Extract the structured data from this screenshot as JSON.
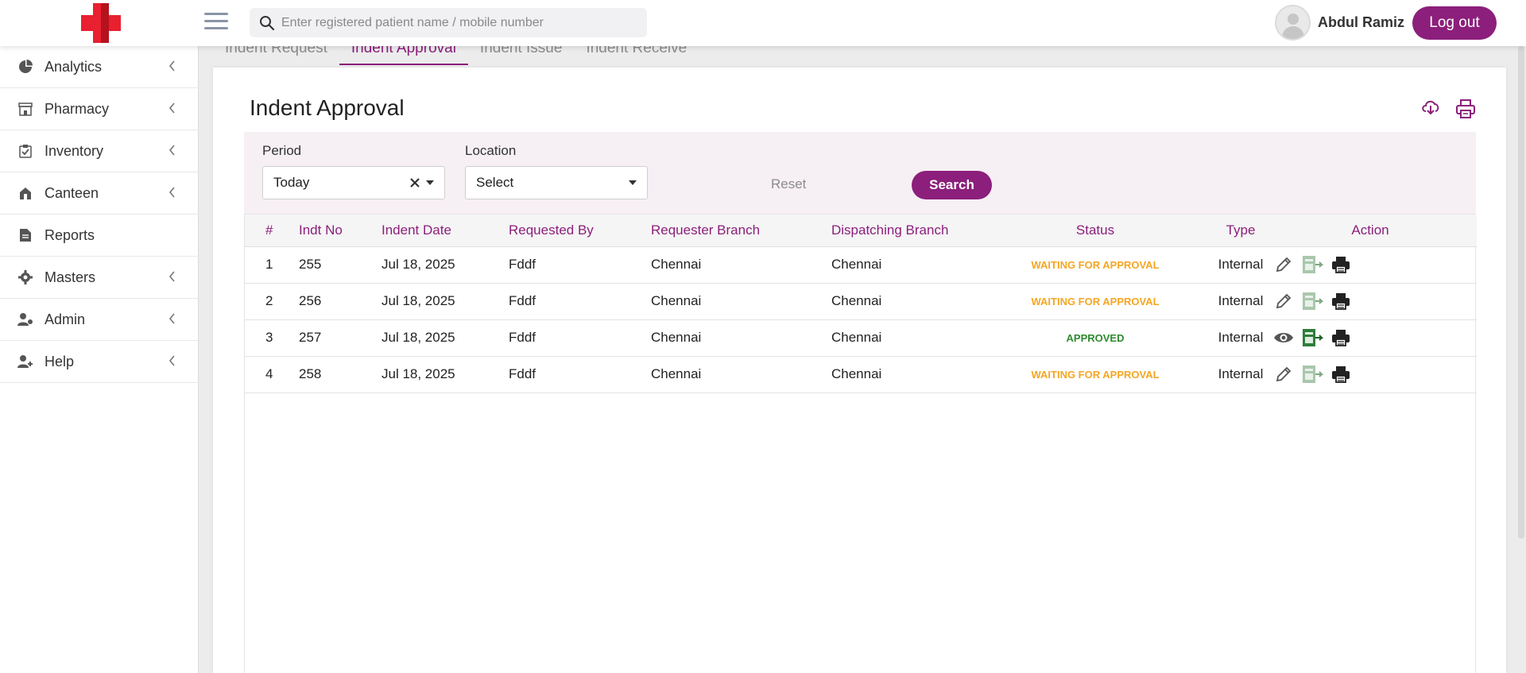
{
  "header": {
    "search_placeholder": "Enter registered patient name / mobile number",
    "user_name": "Abdul Ramiz",
    "logout_label": "Log out"
  },
  "sidebar": {
    "items": [
      {
        "label": "Analytics",
        "icon": "pie-chart-icon",
        "has_chevron": true
      },
      {
        "label": "Pharmacy",
        "icon": "store-icon",
        "has_chevron": true
      },
      {
        "label": "Inventory",
        "icon": "clipboard-check-icon",
        "has_chevron": true
      },
      {
        "label": "Canteen",
        "icon": "canteen-icon",
        "has_chevron": true
      },
      {
        "label": "Reports",
        "icon": "document-icon",
        "has_chevron": false
      },
      {
        "label": "Masters",
        "icon": "gear-icon",
        "has_chevron": true
      },
      {
        "label": "Admin",
        "icon": "user-gear-icon",
        "has_chevron": true
      },
      {
        "label": "Help",
        "icon": "user-plus-icon",
        "has_chevron": true
      }
    ]
  },
  "tabs": [
    {
      "label": "Indent Request",
      "active": false
    },
    {
      "label": "Indent Approval",
      "active": true
    },
    {
      "label": "Indent Issue",
      "active": false
    },
    {
      "label": "Indent Receive",
      "active": false
    }
  ],
  "page": {
    "title": "Indent Approval",
    "download_icon": "cloud-download-icon",
    "print_icon": "printer-icon"
  },
  "filters": {
    "period_label": "Period",
    "period_value": "Today",
    "location_label": "Location",
    "location_value": "Select",
    "search_label": "Search",
    "reset_label": "Reset"
  },
  "table": {
    "columns": [
      "#",
      "Indt No",
      "Indent Date",
      "Requested By",
      "Requester Branch",
      "Dispatching Branch",
      "Status",
      "Type",
      "Action"
    ],
    "rows": [
      {
        "num": "1",
        "indt_no": "255",
        "date": "Jul 18, 2025",
        "requested_by": "Fddf",
        "requester_branch": "Chennai",
        "dispatching_branch": "Chennai",
        "status": "WAITING FOR APPROVAL",
        "type": "Internal",
        "first_action": "edit"
      },
      {
        "num": "2",
        "indt_no": "256",
        "date": "Jul 18, 2025",
        "requested_by": "Fddf",
        "requester_branch": "Chennai",
        "dispatching_branch": "Chennai",
        "status": "WAITING FOR APPROVAL",
        "type": "Internal",
        "first_action": "edit"
      },
      {
        "num": "3",
        "indt_no": "257",
        "date": "Jul 18, 2025",
        "requested_by": "Fddf",
        "requester_branch": "Chennai",
        "dispatching_branch": "Chennai",
        "status": "APPROVED",
        "type": "Internal",
        "first_action": "view"
      },
      {
        "num": "4",
        "indt_no": "258",
        "date": "Jul 18, 2025",
        "requested_by": "Fddf",
        "requester_branch": "Chennai",
        "dispatching_branch": "Chennai",
        "status": "WAITING FOR APPROVAL",
        "type": "Internal",
        "first_action": "edit"
      }
    ]
  },
  "colors": {
    "brand": "#8b1f7b",
    "waiting": "#f5a623",
    "approved": "#2e8b2e",
    "logo_red": "#e8202f"
  }
}
